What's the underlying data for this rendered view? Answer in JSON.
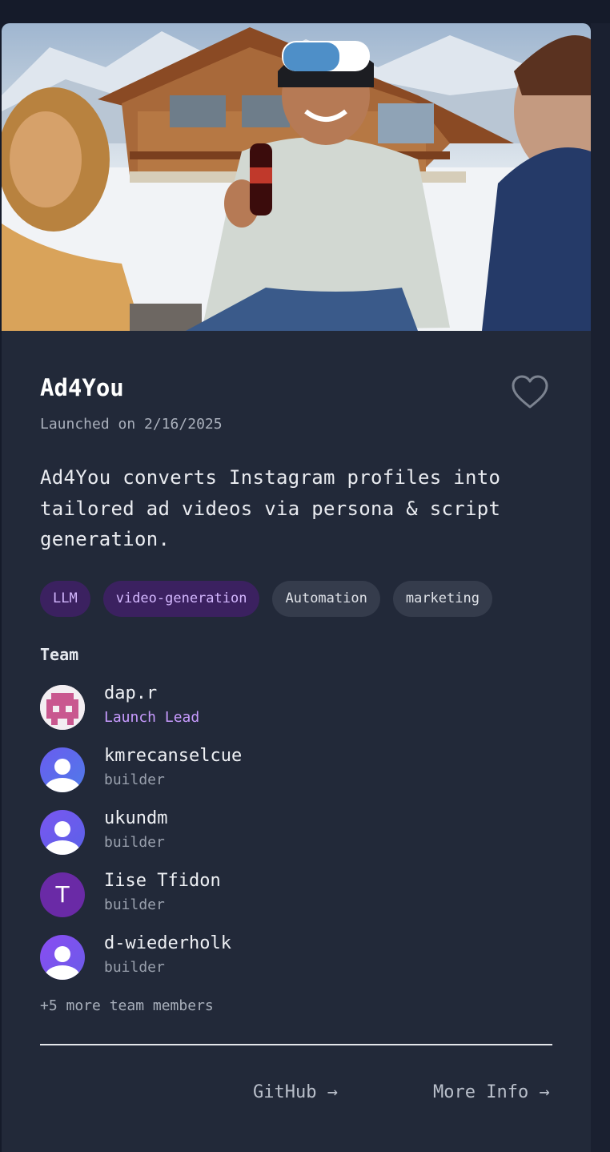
{
  "project": {
    "title": "Ad4You",
    "launched": "Launched on 2/16/2025",
    "description": "Ad4You converts Instagram profiles into tailored ad videos via persona & script generation."
  },
  "tags": [
    {
      "label": "LLM",
      "style": "purple"
    },
    {
      "label": "video-generation",
      "style": "purple"
    },
    {
      "label": "Automation",
      "style": "gray"
    },
    {
      "label": "marketing",
      "style": "gray"
    }
  ],
  "team": {
    "label": "Team",
    "members": [
      {
        "name": "dap.r",
        "role": "Launch Lead",
        "avatar": "pixel-avatar"
      },
      {
        "name": "kmrecanselcue",
        "role": "builder",
        "avatar": "user-icon"
      },
      {
        "name": "ukundm",
        "role": "builder",
        "avatar": "user-icon"
      },
      {
        "name": "Iise Tfidon",
        "role": "builder",
        "avatar": "letter",
        "initial": "T"
      },
      {
        "name": "d-wiederholk",
        "role": "builder",
        "avatar": "user-icon"
      }
    ],
    "more": "+5 more team members"
  },
  "links": {
    "github": "GitHub →",
    "more_info": "More Info →"
  },
  "colors": {
    "card_bg": "#222939",
    "accent_purple": "#c89bff",
    "tag_purple_bg": "#3b2160"
  }
}
